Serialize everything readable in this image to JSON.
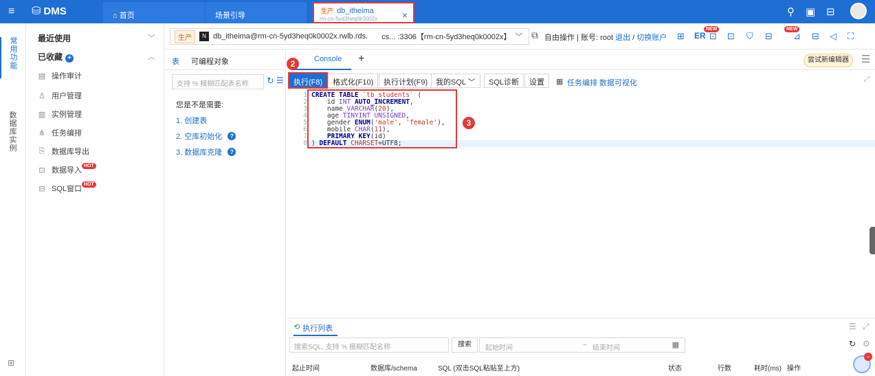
{
  "topbar": {
    "app_name": "DMS",
    "tabs": [
      {
        "label": "首页"
      },
      {
        "label": "场景引导"
      }
    ],
    "active_tab": {
      "env": "生产",
      "name": "db_itheima",
      "sub": "rm-cn-5yd3heq0k0002x"
    }
  },
  "rail": {
    "common": "常用功能",
    "instances": "数据库实例"
  },
  "leftmenu": {
    "recent": "最近使用",
    "favorites": "已收藏",
    "items": [
      {
        "label": "操作审计",
        "icon": "audit-icon"
      },
      {
        "label": "用户管理",
        "icon": "user-icon"
      },
      {
        "label": "实例管理",
        "icon": "instance-icon"
      },
      {
        "label": "任务编排",
        "icon": "flow-icon"
      },
      {
        "label": "数据库导出",
        "icon": "export-icon"
      },
      {
        "label": "数据导入",
        "icon": "import-icon",
        "badge": "HOT"
      },
      {
        "label": "SQL窗口",
        "icon": "sql-window-icon",
        "badge": "HOT"
      }
    ]
  },
  "connection": {
    "env": "生产",
    "text": "db_itheima@rm-cn-5yd3heq0k0002x.rwlb.rds.",
    "text2": "cs... :3306【rm-cn-5yd3heq0k0002x】",
    "mode": "自由操作 | 账号: root",
    "logout": "退出",
    "switch": "切换账户",
    "new_badge": "NEW",
    "er_label": "ER"
  },
  "objpanel": {
    "tab_table": "表",
    "tab_programmable": "可编程对象",
    "search_placeholder": "支持 % 模糊匹配表名称",
    "hint_title": "您是不是需要:",
    "hints": [
      "1. 创建表",
      "2. 空库初始化",
      "3. 数据库克隆"
    ]
  },
  "console": {
    "tab_label": "Console",
    "try_new_editor": "尝试新编辑器",
    "toolbar": {
      "run": "执行(F8)",
      "format": "格式化(F10)",
      "plan": "执行计划(F9)",
      "my_sql": "我的SQL",
      "diagnose": "SQL诊断",
      "settings": "设置",
      "task_flow": "任务编排",
      "visualize": "数据可视化"
    },
    "line_numbers": [
      "1",
      "2",
      "3",
      "4",
      "5",
      "6",
      "7",
      "8"
    ]
  },
  "exec": {
    "tab_label": "执行列表",
    "search_placeholder": "搜索SQL, 支持 % 模糊匹配名称",
    "search_btn": "搜索",
    "start_time": "起始时间",
    "sep": "~",
    "end_time": "结束时间",
    "columns": [
      "起止时间",
      "数据库/schema",
      "SQL (双击SQL粘贴至上方)",
      "状态",
      "行数",
      "耗时(ms)",
      "操作"
    ]
  },
  "markers": [
    "1",
    "2",
    "3"
  ]
}
